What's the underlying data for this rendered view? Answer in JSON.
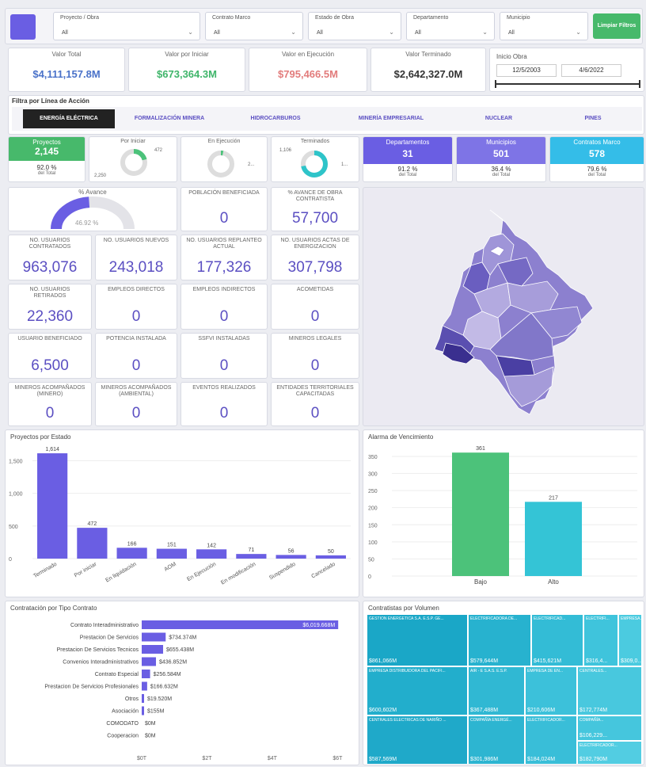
{
  "filters": {
    "logo_color": "#6a5ee3",
    "items": [
      {
        "label": "Proyecto / Obra",
        "value": "All"
      },
      {
        "label": "Contrato Marco",
        "value": "All"
      },
      {
        "label": "Estado de Obra",
        "value": "All"
      },
      {
        "label": "Departamento",
        "value": "All"
      },
      {
        "label": "Municipio",
        "value": "All"
      }
    ],
    "clear_button": "Limpiar Filtros"
  },
  "values": {
    "total": {
      "label": "Valor Total",
      "value": "$4,111,157.8M",
      "color": "#4a72c9"
    },
    "por_iniciar": {
      "label": "Valor por Iniciar",
      "value": "$673,364.3M",
      "color": "#3fb56a"
    },
    "ejecucion": {
      "label": "Valor en Ejecución",
      "value": "$795,466.5M",
      "color": "#e27c7c"
    },
    "terminado": {
      "label": "Valor Terminado",
      "value": "$2,642,327.0M",
      "color": "#333333"
    }
  },
  "date_filter": {
    "label": "Inicio Obra",
    "start": "12/5/2003",
    "end": "4/6/2022"
  },
  "lineas": {
    "title": "Filtra por Línea de Acción",
    "tabs": [
      "ENERGÍA ELÉCTRICA",
      "FORMALIZACIÓN MINERA",
      "HIDROCARBUROS",
      "MINERÍA EMPRESARIAL",
      "NUCLEAR",
      "PINES"
    ]
  },
  "kpis": {
    "proyectos": {
      "label": "Proyectos",
      "value": "2,145",
      "pct": "92.0 %",
      "sub": "del Total"
    },
    "por_iniciar": {
      "label": "Por Iniciar",
      "max": "2,250",
      "value": "472",
      "fraction": 0.21
    },
    "en_ejecucion": {
      "label": "En Ejecución",
      "value": "2...",
      "fraction": 0.03
    },
    "terminados": {
      "label": "Terminados",
      "max": "1,106",
      "value": "1...",
      "fraction": 0.72
    },
    "departamentos": {
      "label": "Departamentos",
      "value": "31",
      "pct": "91.2 %",
      "sub": "del Total"
    },
    "municipios": {
      "label": "Municipios",
      "value": "501",
      "pct": "36.4 %",
      "sub": "del Total"
    },
    "contratos": {
      "label": "Contratos Marco",
      "value": "578",
      "pct": "79.6 %",
      "sub": "del Total"
    }
  },
  "gauge": {
    "label": "% Avance",
    "value": "46.92 %",
    "fraction": 0.4692
  },
  "metrics": [
    {
      "label": "POBLACIÓN BENEFICIADA",
      "value": "0"
    },
    {
      "label": "% AVANCE DE OBRA CONTRATISTA",
      "value": "57,700"
    },
    {
      "label": "NO. USUARIOS CONTRATADOS",
      "value": "963,076"
    },
    {
      "label": "NO. USUARIOS NUEVOS",
      "value": "243,018"
    },
    {
      "label": "NO. USUARIOS REPLANTEO ACTUAL",
      "value": "177,326"
    },
    {
      "label": "NO. USUARIOS ACTAS DE ENERGIZACION",
      "value": "307,798"
    },
    {
      "label": "NO. USUARIOS RETIRADOS",
      "value": "22,360"
    },
    {
      "label": "EMPLEOS DIRECTOS",
      "value": "0"
    },
    {
      "label": "EMPLEOS INDIRECTOS",
      "value": "0"
    },
    {
      "label": "ACOMETIDAS",
      "value": "0"
    },
    {
      "label": "USUARIO BENEFICIADO",
      "value": "6,500"
    },
    {
      "label": "POTENCIA INSTALADA",
      "value": "0"
    },
    {
      "label": "SSFVI INSTALADAS",
      "value": "0"
    },
    {
      "label": "MINEROS LEGALES",
      "value": "0"
    },
    {
      "label": "MINEROS ACOMPAÑADOS (MINERO)",
      "value": "0"
    },
    {
      "label": "MINEROS ACOMPAÑADOS (AMBIENTAL)",
      "value": "0"
    },
    {
      "label": "EVENTOS REALIZADOS",
      "value": "0"
    },
    {
      "label": "ENTIDADES TERRITORIALES CAPACITADAS",
      "value": "0"
    }
  ],
  "chart_data": [
    {
      "type": "bar",
      "title": "Proyectos por Estado",
      "categories": [
        "Terminado",
        "Por iniciar",
        "En liquidación",
        "AOM",
        "En Ejecución",
        "En modificación",
        "Suspendido",
        "Cancelado"
      ],
      "values": [
        1614,
        472,
        166,
        151,
        142,
        71,
        56,
        50
      ],
      "yticks": [
        "0",
        "500",
        "1,000",
        "1,500"
      ],
      "ylim": [
        0,
        1700
      ],
      "color": "#6a5ee3"
    },
    {
      "type": "bar",
      "title": "Alarma de Vencimiento",
      "categories": [
        "Bajo",
        "Alto"
      ],
      "values": [
        361,
        217
      ],
      "yticks": [
        "0",
        "50",
        "100",
        "150",
        "200",
        "250",
        "300",
        "350"
      ],
      "ylim": [
        0,
        380
      ],
      "colors": [
        "#4cc27a",
        "#34c4d6"
      ]
    },
    {
      "type": "bar",
      "orientation": "horizontal",
      "title": "Contratación por Tipo Contrato",
      "categories": [
        "Contrato Interadministrativo",
        "Prestacion De Servicios",
        "Prestacion De Servicios Tecnicos",
        "Convenios Interadministrativos",
        "Contrato Especial",
        "Prestacion De Servicios Profesionales",
        "Otros",
        "Asociación",
        "COMODATO",
        "Cooperacion"
      ],
      "values": [
        6019.668,
        734.374,
        655.438,
        436.852,
        256.584,
        166.632,
        19.52,
        0.155,
        0,
        0
      ],
      "value_labels": [
        "$6,019.668M",
        "$734.374M",
        "$655.438M",
        "$436.852M",
        "$256.584M",
        "$166.632M",
        "$19.520M",
        "$155M",
        "$0M",
        "$0M"
      ],
      "xticks": [
        "$0T",
        "$2T",
        "$4T",
        "$6T"
      ],
      "xlim": [
        0,
        6500
      ],
      "color": "#6a5ee3"
    },
    {
      "type": "treemap",
      "title": "Contratistas por Volumen",
      "tiles": [
        {
          "name": "GESTION ENERGETICA S.A. E.S.P. GE...",
          "value": "$861,066M"
        },
        {
          "name": "ELECTRIFICADORA DE...",
          "value": "$579,644M"
        },
        {
          "name": "ELECTRIFICAD...",
          "value": "$415,621M"
        },
        {
          "name": "ELECTRIFI...",
          "value": "$316,4..."
        },
        {
          "name": "EMPRESA...",
          "value": "$309,0..."
        },
        {
          "name": "EMPRESA DISTRIBUIDORA DEL PACIFI...",
          "value": "$600,602M"
        },
        {
          "name": "AIR - E S.A.S. E.S.P.",
          "value": "$367,488M"
        },
        {
          "name": "EMPRESA DE EN...",
          "value": "$210,606M"
        },
        {
          "name": "CENTRALES...",
          "value": "$172,774M"
        },
        {
          "name": "CENTRALES ELECTRICAS DE NARIÑO ...",
          "value": "$587,569M"
        },
        {
          "name": "COMPAÑÍA ENERGÉ...",
          "value": "$301,986M"
        },
        {
          "name": "ELECTRIFICADOR...",
          "value": "$184,024M"
        },
        {
          "name": "COMPAÑÍA...",
          "value": "$106,229..."
        },
        {
          "name": "ELECTRIFICADOR...",
          "value": "$182,790M"
        }
      ]
    }
  ]
}
